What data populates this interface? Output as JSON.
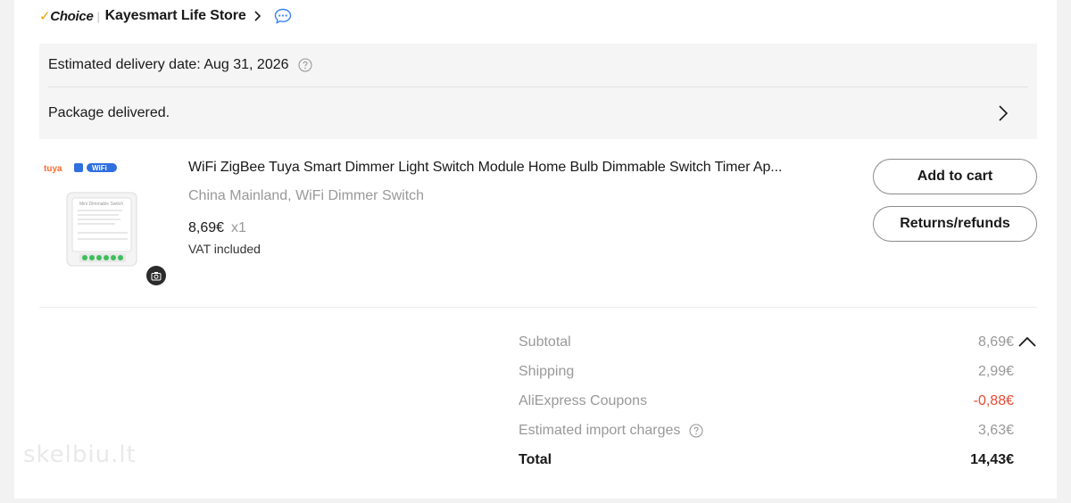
{
  "store": {
    "choice_label": "Choice",
    "name": "Kayesmart Life Store"
  },
  "delivery": {
    "estimated": "Estimated delivery date: Aug 31, 2026",
    "status": "Package delivered."
  },
  "product": {
    "title": "WiFi ZigBee Tuya Smart Dimmer Light Switch Module Home Bulb Dimmable Switch Timer Ap...",
    "variant": "China Mainland, WiFi Dimmer Switch",
    "price": "8,69€",
    "quantity": "x1",
    "vat": "VAT included",
    "image_badges": [
      "tuya",
      "WiFi"
    ],
    "image_caption": "Mini Dimmable Switch"
  },
  "actions": {
    "add_to_cart": "Add to cart",
    "returns": "Returns/refunds"
  },
  "summary": {
    "rows": [
      {
        "label": "Subtotal",
        "value": "8,69€"
      },
      {
        "label": "Shipping",
        "value": "2,99€"
      },
      {
        "label": "AliExpress Coupons",
        "value": "-0,88€"
      },
      {
        "label": "Estimated import charges",
        "value": "3,63€"
      }
    ],
    "total_label": "Total",
    "total_value": "14,43€"
  },
  "watermark": "skelbiu.lt",
  "colors": {
    "choice_check": "#f0a500",
    "coupon_red": "#e64b33",
    "chat_blue": "#3b82f6",
    "wifi_blue": "#2f6fe0"
  },
  "icons": [
    "chevron-right-icon",
    "chat-icon",
    "help-icon",
    "camera-icon",
    "chevron-up-icon"
  ]
}
